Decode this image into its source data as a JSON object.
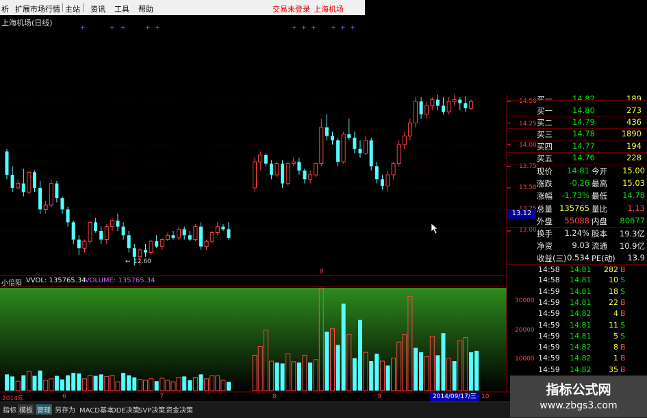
{
  "menu": {
    "items": [
      "析",
      "扩展市场行情",
      "主站",
      "资讯",
      "工具",
      "帮助"
    ],
    "right_items": [
      "交易未登录",
      "上海机场"
    ]
  },
  "chart_title": "上海机场(日线)",
  "marker_glyph": "+",
  "min_label": "12.60",
  "min_label_prefix": "←",
  "price_axis": {
    "ticks": [
      "14.50",
      "14.25",
      "14.00",
      "13.75",
      "13.50",
      "13.25",
      "13.00"
    ],
    "current": "13.12"
  },
  "volume_header": {
    "indicator": "小倍阳",
    "vvol": "VVOL: 135765.34",
    "volume": "VOLUME: 135765.34"
  },
  "volume_axis": {
    "ticks": [
      "30000",
      "20000",
      "10000"
    ]
  },
  "date_axis": {
    "labels": [
      "2014年",
      "6",
      "7",
      "8",
      "9",
      "10"
    ],
    "cursor_date": "2014/09/17/三"
  },
  "middle_marker": "8",
  "quotes": [
    {
      "label": "买一",
      "price": "14.82",
      "vol": "189",
      "cut": true
    },
    {
      "label": "买一",
      "price": "14.80",
      "vol": "273"
    },
    {
      "label": "买二",
      "price": "14.79",
      "vol": "436"
    },
    {
      "label": "买三",
      "price": "14.78",
      "vol": "1890"
    },
    {
      "label": "买四",
      "price": "14.77",
      "vol": "194"
    },
    {
      "label": "买五",
      "price": "14.76",
      "vol": "228"
    }
  ],
  "stats": [
    {
      "l1": "现价",
      "v1": "14.81",
      "l2": "今开",
      "v2": "15.00"
    },
    {
      "l1": "涨跌",
      "v1": "-0.26",
      "l2": "最高",
      "v2": "15.03"
    },
    {
      "l1": "涨幅",
      "v1": "-1.73%",
      "l2": "最低",
      "v2": "14.78"
    },
    {
      "l1": "总量",
      "v1": "135765",
      "l2": "量比",
      "v2": "1.13"
    },
    {
      "l1": "外盘",
      "v1": "55088",
      "l2": "内盘",
      "v2": "80677"
    },
    {
      "l1": "换手",
      "v1": "1.24%",
      "l2": "股本",
      "v2": "19.3亿"
    },
    {
      "l1": "净资",
      "v1": "9.03",
      "l2": "流通",
      "v2": "10.9亿"
    },
    {
      "l1": "收益(三)",
      "v1": "0.534",
      "l2": "PE(动)",
      "v2": "13.9"
    }
  ],
  "trades": [
    {
      "time": "14:58",
      "price": "14.81",
      "vol": "282",
      "dir": "B"
    },
    {
      "time": "14:58",
      "price": "14.81",
      "vol": "10",
      "dir": "S"
    },
    {
      "time": "14:59",
      "price": "14.81",
      "vol": "18",
      "dir": "S"
    },
    {
      "time": "14:59",
      "price": "14.81",
      "vol": "22",
      "dir": "B"
    },
    {
      "time": "14:59",
      "price": "14.82",
      "vol": "4",
      "dir": "B"
    },
    {
      "time": "14:59",
      "price": "14.81",
      "vol": "11",
      "dir": "S"
    },
    {
      "time": "14:59",
      "price": "14.81",
      "vol": "5",
      "dir": "S"
    },
    {
      "time": "14:59",
      "price": "14.82",
      "vol": "8",
      "dir": "B"
    },
    {
      "time": "14:59",
      "price": "14.82",
      "vol": "1",
      "dir": "B"
    },
    {
      "time": "14:59",
      "price": "14.82",
      "vol": "35",
      "dir": "B"
    }
  ],
  "bottom_tabs": [
    "指标",
    "模板",
    "管理",
    "另存为",
    "MACD基本",
    "DDE决策",
    "SVP决策",
    "资金决策"
  ],
  "watermark": {
    "line1": "指标公式网",
    "line2": "www.zbgs3.com"
  },
  "colors": {
    "up": "#ff4646",
    "down": "#54ffff",
    "green": "#00e400",
    "yellow": "#ffff40",
    "grid": "#8b0000"
  },
  "chart_data": {
    "type": "candlestick",
    "title": "上海机场(日线)",
    "y_ticks": [
      14.5,
      14.25,
      14.0,
      13.75,
      13.5,
      13.25,
      13.0
    ],
    "ylim": [
      12.35,
      14.58
    ],
    "candles": [
      [
        13.92,
        13.95,
        13.6,
        13.65
      ],
      [
        13.65,
        13.75,
        13.45,
        13.5
      ],
      [
        13.5,
        13.6,
        13.48,
        13.55
      ],
      [
        13.55,
        13.72,
        13.4,
        13.45
      ],
      [
        13.45,
        13.7,
        13.42,
        13.68
      ],
      [
        13.68,
        13.7,
        13.45,
        13.5
      ],
      [
        13.5,
        13.58,
        13.2,
        13.25
      ],
      [
        13.25,
        13.35,
        13.2,
        13.3
      ],
      [
        13.3,
        13.6,
        13.28,
        13.55
      ],
      [
        13.55,
        13.58,
        13.33,
        13.38
      ],
      [
        13.38,
        13.4,
        13.2,
        13.25
      ],
      [
        13.25,
        13.28,
        13.05,
        13.1
      ],
      [
        13.1,
        13.12,
        12.85,
        12.9
      ],
      [
        12.9,
        12.95,
        12.72,
        12.8
      ],
      [
        12.8,
        12.9,
        12.75,
        12.88
      ],
      [
        12.88,
        13.12,
        12.85,
        13.1
      ],
      [
        13.1,
        13.15,
        12.98,
        13.0
      ],
      [
        13.0,
        13.05,
        12.85,
        12.9
      ],
      [
        12.9,
        13.08,
        12.85,
        13.05
      ],
      [
        13.05,
        13.15,
        13.0,
        13.12
      ],
      [
        13.12,
        13.2,
        13.0,
        13.05
      ],
      [
        13.05,
        13.1,
        12.9,
        12.95
      ],
      [
        12.95,
        13.0,
        12.75,
        12.8
      ],
      [
        12.8,
        12.85,
        12.6,
        12.7
      ],
      [
        12.7,
        12.8,
        12.6,
        12.78
      ],
      [
        12.78,
        12.85,
        12.7,
        12.75
      ],
      [
        12.75,
        12.9,
        12.72,
        12.88
      ],
      [
        12.88,
        12.95,
        12.8,
        12.82
      ],
      [
        12.82,
        12.92,
        12.78,
        12.9
      ],
      [
        12.9,
        12.98,
        12.88,
        12.95
      ],
      [
        12.95,
        13.0,
        12.9,
        12.92
      ],
      [
        12.92,
        13.05,
        12.9,
        13.02
      ],
      [
        13.02,
        13.05,
        12.9,
        12.95
      ],
      [
        12.95,
        13.0,
        12.88,
        12.9
      ],
      [
        12.9,
        13.08,
        12.88,
        13.05
      ],
      [
        13.05,
        13.1,
        12.78,
        12.82
      ],
      [
        12.82,
        12.9,
        12.78,
        12.88
      ],
      [
        12.88,
        13.0,
        12.85,
        12.98
      ],
      [
        12.98,
        13.1,
        12.95,
        13.05
      ],
      [
        13.05,
        13.08,
        13.0,
        13.02
      ],
      [
        13.02,
        13.1,
        12.9,
        12.92
      ],
      [
        13.5,
        13.85,
        13.45,
        13.8
      ],
      [
        13.8,
        13.92,
        13.7,
        13.88
      ],
      [
        13.88,
        13.9,
        13.75,
        13.78
      ],
      [
        13.78,
        13.82,
        13.6,
        13.65
      ],
      [
        13.65,
        13.8,
        13.62,
        13.78
      ],
      [
        13.78,
        13.82,
        13.5,
        13.55
      ],
      [
        13.55,
        13.8,
        13.52,
        13.78
      ],
      [
        13.78,
        13.85,
        13.75,
        13.8
      ],
      [
        13.8,
        13.85,
        13.65,
        13.7
      ],
      [
        13.7,
        13.72,
        13.55,
        13.6
      ],
      [
        13.6,
        13.7,
        13.55,
        13.65
      ],
      [
        13.65,
        13.8,
        13.62,
        13.78
      ],
      [
        13.78,
        14.3,
        13.75,
        14.2
      ],
      [
        14.2,
        14.35,
        14.05,
        14.1
      ],
      [
        14.1,
        14.15,
        14.0,
        14.05
      ],
      [
        14.05,
        14.08,
        13.75,
        13.8
      ],
      [
        13.8,
        14.15,
        13.78,
        14.12
      ],
      [
        14.12,
        14.3,
        14.05,
        14.08
      ],
      [
        14.08,
        14.15,
        13.9,
        13.95
      ],
      [
        13.95,
        14.05,
        13.85,
        13.9
      ],
      [
        13.9,
        14.1,
        13.88,
        14.05
      ],
      [
        14.05,
        14.08,
        13.7,
        13.75
      ],
      [
        13.75,
        13.8,
        13.55,
        13.6
      ],
      [
        13.6,
        13.65,
        13.48,
        13.52
      ],
      [
        13.52,
        13.7,
        13.45,
        13.65
      ],
      [
        13.65,
        13.8,
        13.6,
        13.78
      ],
      [
        13.78,
        14.05,
        13.75,
        14.0
      ],
      [
        14.0,
        14.15,
        13.95,
        14.1
      ],
      [
        14.1,
        14.3,
        14.05,
        14.25
      ],
      [
        14.25,
        14.55,
        14.2,
        14.5
      ],
      [
        14.5,
        14.55,
        14.3,
        14.35
      ],
      [
        14.35,
        14.5,
        14.3,
        14.45
      ],
      [
        14.45,
        14.55,
        14.4,
        14.52
      ],
      [
        14.52,
        14.58,
        14.4,
        14.45
      ],
      [
        14.45,
        14.55,
        14.35,
        14.38
      ],
      [
        14.38,
        14.55,
        14.35,
        14.5
      ],
      [
        14.5,
        14.58,
        14.45,
        14.52
      ],
      [
        14.52,
        14.55,
        14.4,
        14.48
      ],
      [
        14.48,
        14.56,
        14.38,
        14.42
      ],
      [
        14.42,
        14.52,
        14.4,
        14.5
      ]
    ],
    "volume": [
      {
        "v": 5500,
        "up": false
      },
      {
        "v": 4800,
        "up": false
      },
      {
        "v": 3200,
        "up": true
      },
      {
        "v": 5200,
        "up": false
      },
      {
        "v": 6500,
        "up": true
      },
      {
        "v": 5000,
        "up": false
      },
      {
        "v": 6800,
        "up": false
      },
      {
        "v": 3500,
        "up": true
      },
      {
        "v": 4000,
        "up": true
      },
      {
        "v": 5000,
        "up": false
      },
      {
        "v": 3800,
        "up": false
      },
      {
        "v": 5200,
        "up": false
      },
      {
        "v": 6000,
        "up": false
      },
      {
        "v": 5800,
        "up": false
      },
      {
        "v": 4000,
        "up": true
      },
      {
        "v": 5200,
        "up": true
      },
      {
        "v": 5000,
        "up": false
      },
      {
        "v": 5500,
        "up": false
      },
      {
        "v": 4800,
        "up": true
      },
      {
        "v": 5200,
        "up": true
      },
      {
        "v": 3000,
        "up": true
      },
      {
        "v": 6000,
        "up": false
      },
      {
        "v": 5200,
        "up": false
      },
      {
        "v": 4500,
        "up": false
      },
      {
        "v": 3800,
        "up": true
      },
      {
        "v": 3500,
        "up": true
      },
      {
        "v": 4000,
        "up": true
      },
      {
        "v": 3200,
        "up": false
      },
      {
        "v": 4200,
        "up": true
      },
      {
        "v": 3500,
        "up": true
      },
      {
        "v": 3000,
        "up": true
      },
      {
        "v": 4500,
        "up": true
      },
      {
        "v": 4800,
        "up": false
      },
      {
        "v": 3500,
        "up": false
      },
      {
        "v": 4500,
        "up": true
      },
      {
        "v": 5500,
        "up": false
      },
      {
        "v": 4000,
        "up": true
      },
      {
        "v": 5000,
        "up": true
      },
      {
        "v": 5000,
        "up": true
      },
      {
        "v": 3500,
        "up": true
      },
      {
        "v": 3000,
        "up": false
      },
      {
        "v": 12000,
        "up": true
      },
      {
        "v": 15000,
        "up": true
      },
      {
        "v": 20500,
        "up": true
      },
      {
        "v": 10000,
        "up": true
      },
      {
        "v": 9500,
        "up": false
      },
      {
        "v": 9200,
        "up": false
      },
      {
        "v": 12500,
        "up": true
      },
      {
        "v": 9800,
        "up": true
      },
      {
        "v": 9500,
        "up": false
      },
      {
        "v": 12000,
        "up": true
      },
      {
        "v": 9500,
        "up": false
      },
      {
        "v": 10500,
        "up": true
      },
      {
        "v": 34800,
        "up": true
      },
      {
        "v": 20000,
        "up": false
      },
      {
        "v": 21000,
        "up": true
      },
      {
        "v": 15500,
        "up": false
      },
      {
        "v": 29500,
        "up": false
      },
      {
        "v": 19000,
        "up": true
      },
      {
        "v": 11000,
        "up": false
      },
      {
        "v": 24000,
        "up": false
      },
      {
        "v": 13000,
        "up": true
      },
      {
        "v": 10000,
        "up": false
      },
      {
        "v": 12500,
        "up": false
      },
      {
        "v": 10000,
        "up": true
      },
      {
        "v": 8500,
        "up": false
      },
      {
        "v": 11000,
        "up": true
      },
      {
        "v": 16500,
        "up": true
      },
      {
        "v": 19000,
        "up": true
      },
      {
        "v": 32000,
        "up": true
      },
      {
        "v": 14500,
        "up": false
      },
      {
        "v": 13000,
        "up": false
      },
      {
        "v": 11500,
        "up": true
      },
      {
        "v": 18500,
        "up": true
      },
      {
        "v": 12000,
        "up": false
      },
      {
        "v": 19500,
        "up": false
      },
      {
        "v": 11000,
        "up": true
      },
      {
        "v": 10000,
        "up": false
      },
      {
        "v": 17000,
        "up": true
      },
      {
        "v": 18000,
        "up": true
      },
      {
        "v": 13000,
        "up": false
      },
      {
        "v": 13500,
        "up": false
      }
    ],
    "gap_index": 41
  }
}
